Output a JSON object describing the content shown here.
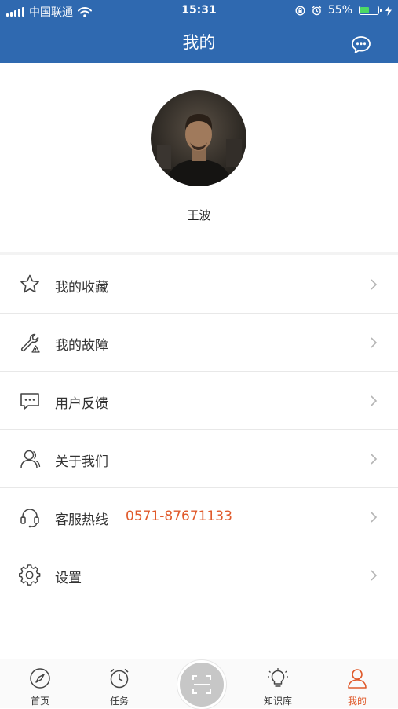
{
  "status_bar": {
    "carrier": "中国联通",
    "time": "15:31",
    "battery": "55%"
  },
  "header": {
    "title": "我的",
    "message_icon": "chat-bubble-icon"
  },
  "profile": {
    "name": "王波"
  },
  "menu": [
    {
      "label": "我的收藏",
      "icon": "star-icon"
    },
    {
      "label": "我的故障",
      "icon": "wrench-warning-icon"
    },
    {
      "label": "用户反馈",
      "icon": "feedback-message-icon"
    },
    {
      "label": "关于我们",
      "icon": "people-icon"
    },
    {
      "label": "客服热线",
      "icon": "headset-icon",
      "phone": "0571-87671133"
    },
    {
      "label": "设置",
      "icon": "gear-icon"
    }
  ],
  "tabbar": {
    "tabs": [
      {
        "label": "首页",
        "icon": "compass-icon"
      },
      {
        "label": "任务",
        "icon": "alarm-clock-icon"
      },
      {
        "label": "知识库",
        "icon": "lightbulb-icon"
      },
      {
        "label": "我的",
        "icon": "person-icon",
        "active": true
      }
    ],
    "center_button_icon": "scan-icon"
  },
  "colors": {
    "header": "#2f69b0",
    "accent": "#e05a2b",
    "battery": "#4cd964"
  }
}
